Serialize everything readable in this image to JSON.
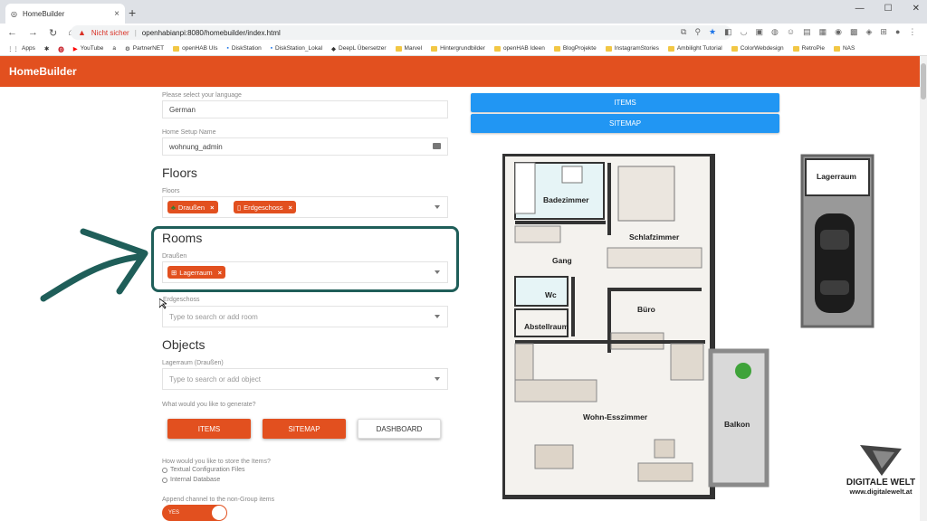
{
  "browser": {
    "tab_title": "HomeBuilder",
    "new_tab": "+",
    "insecure_label": "Nicht sicher",
    "url": "openhabianpi:8080/homebuilder/index.html",
    "bookmarks": [
      "Apps",
      "",
      "",
      "YouTube",
      "",
      "PartnerNET",
      "openHAB UIs",
      "DiskStation",
      "DiskStation_Lokal",
      "DeepL Übersetzer",
      "Marvel",
      "Hintergrundbilder",
      "openHAB Ideen",
      "BlogProjekte",
      "InstagramStories",
      "Ambilight Tutorial",
      "ColorWebdesign",
      "RetroPie",
      "NAS"
    ]
  },
  "app": {
    "title": "HomeBuilder",
    "language_label": "Please select your language",
    "language_value": "German",
    "setup_label": "Home Setup Name",
    "setup_value": "wohnung_admin",
    "floors_header": "Floors",
    "floors_label": "Floors",
    "floors_chips": [
      "Draußen",
      "Erdgeschoss"
    ],
    "rooms_header": "Rooms",
    "rooms_outside_label": "Draußen",
    "rooms_outside_chip": "Lagerraum",
    "rooms_ground_label": "Erdgeschoss",
    "rooms_ground_placeholder": "Type to search or add room",
    "objects_header": "Objects",
    "objects_label": "Lagerraum (Draußen)",
    "objects_placeholder": "Type to search or add object",
    "generate_label": "What would you like to generate?",
    "gen_items": "ITEMS",
    "gen_sitemap": "SITEMAP",
    "gen_dashboard": "DASHBOARD",
    "store_label": "How would you like to store the Items?",
    "store_opt1": "Textual Configuration Files",
    "store_opt2": "Internal Database",
    "append_label": "Append channel to the non-Group items",
    "toggle_label": "YES",
    "right_items": "ITEMS",
    "right_sitemap": "SITEMAP"
  },
  "floorplan": {
    "rooms": [
      "Badezimmer",
      "Schlafzimmer",
      "Gang",
      "Wc",
      "Büro",
      "Abstellraum",
      "Wohn-Esszimmer",
      "Balkon"
    ],
    "garage_room": "Lagerraum"
  },
  "watermark": {
    "brand": "DIGITALE WELT",
    "url": "www.digitalewelt.at"
  },
  "colors": {
    "accent": "#e2501f",
    "blue": "#2196f3",
    "highlight": "#1f5e59"
  }
}
